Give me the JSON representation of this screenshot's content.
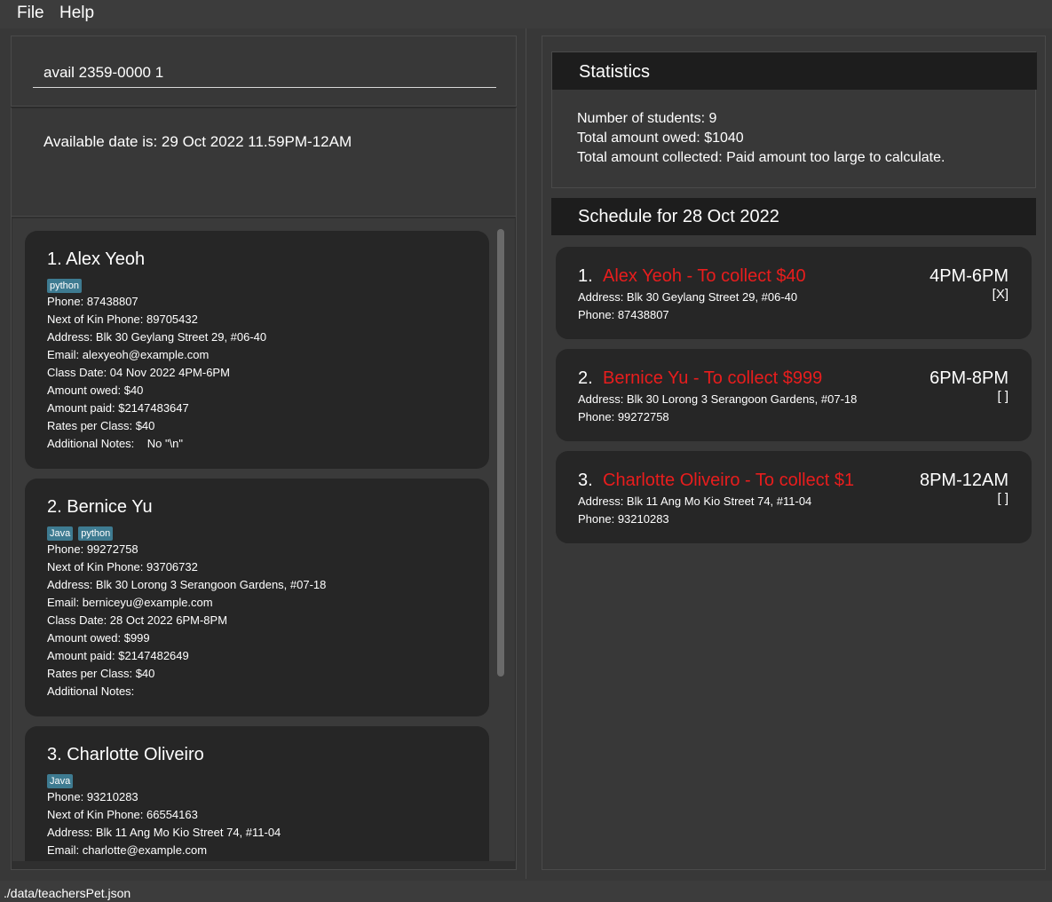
{
  "menu": {
    "file": "File",
    "help": "Help"
  },
  "command": {
    "value": "avail 2359-0000 1"
  },
  "result": {
    "text": "Available date is: 29 Oct 2022 11.59PM-12AM"
  },
  "persons": [
    {
      "name": "1.  Alex Yeoh",
      "tags": [
        "python"
      ],
      "phone": "Phone: 87438807",
      "nok": "Next of Kin Phone: 89705432",
      "address": "Address: Blk 30 Geylang Street 29, #06-40",
      "email": "Email: alexyeoh@example.com",
      "class_date": "Class Date: 04 Nov 2022 4PM-6PM",
      "owed": "Amount owed: $40",
      "paid": "Amount paid: $2147483647",
      "rates": "Rates per Class: $40",
      "notes": "Additional Notes:    No \"\\n\""
    },
    {
      "name": "2.  Bernice Yu",
      "tags": [
        "Java",
        "python"
      ],
      "phone": "Phone: 99272758",
      "nok": "Next of Kin Phone: 93706732",
      "address": "Address: Blk 30 Lorong 3 Serangoon Gardens, #07-18",
      "email": "Email: berniceyu@example.com",
      "class_date": "Class Date: 28 Oct 2022 6PM-8PM",
      "owed": "Amount owed: $999",
      "paid": "Amount paid: $2147482649",
      "rates": "Rates per Class: $40",
      "notes": "Additional Notes:"
    },
    {
      "name": "3.  Charlotte Oliveiro",
      "tags": [
        "Java"
      ],
      "phone": "Phone: 93210283",
      "nok": "Next of Kin Phone: 66554163",
      "address": "Address: Blk 11 Ang Mo Kio Street 74, #11-04",
      "email": "Email: charlotte@example.com"
    }
  ],
  "statistics": {
    "title": "Statistics",
    "students": "Number of students: 9",
    "owed": "Total amount owed: $1040",
    "collected": "Total amount collected: Paid amount too large to calculate."
  },
  "schedule": {
    "title": "Schedule for 28 Oct 2022",
    "items": [
      {
        "index": "1.",
        "title": "Alex Yeoh - To collect $40",
        "time": "4PM-6PM",
        "mark": "[X]",
        "address": "Address: Blk 30 Geylang Street 29, #06-40",
        "phone": "Phone: 87438807"
      },
      {
        "index": "2.",
        "title": "Bernice Yu - To collect $999",
        "time": "6PM-8PM",
        "mark": "[ ]",
        "address": "Address: Blk 30 Lorong 3 Serangoon Gardens, #07-18",
        "phone": "Phone: 99272758"
      },
      {
        "index": "3.",
        "title": "Charlotte Oliveiro - To collect $1",
        "time": "8PM-12AM",
        "mark": "[ ]",
        "address": "Address: Blk 11 Ang Mo Kio Street 74, #11-04",
        "phone": "Phone: 93210283"
      }
    ]
  },
  "status": {
    "path": "./data/teachersPet.json"
  },
  "colors": {
    "background": "#383838",
    "card": "#262626",
    "header": "#1d1d1d",
    "tag": "#3e7b91",
    "collect_red": "#e81d1d"
  }
}
